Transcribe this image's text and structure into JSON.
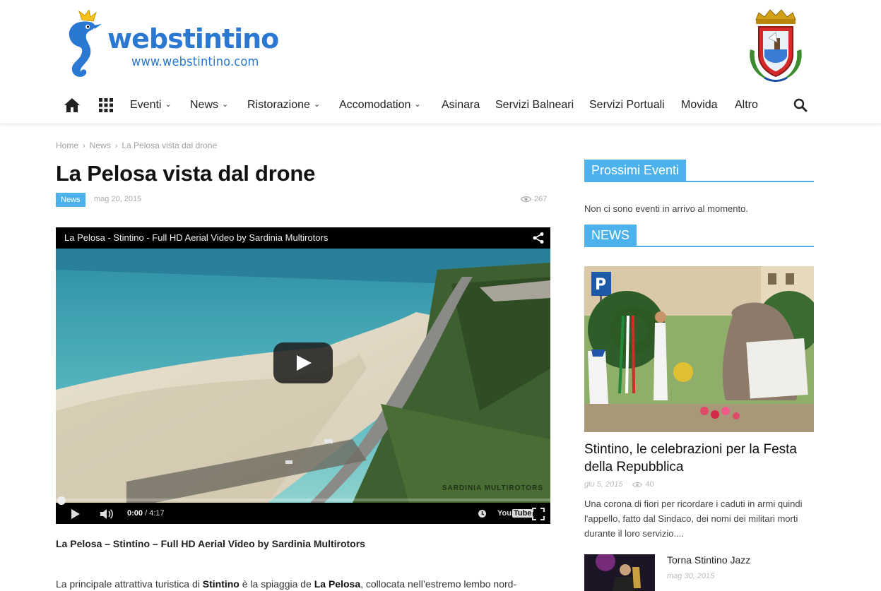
{
  "header": {
    "logo_text": "webstintino",
    "logo_url": "www.webstintino.com"
  },
  "nav": {
    "items": [
      {
        "label": "Eventi",
        "dropdown": true
      },
      {
        "label": "News",
        "dropdown": true
      },
      {
        "label": "Ristorazione",
        "dropdown": true
      },
      {
        "label": "Accomodation",
        "dropdown": true
      },
      {
        "label": "Asinara",
        "dropdown": false
      },
      {
        "label": "Servizi Balneari",
        "dropdown": false
      },
      {
        "label": "Servizi Portuali",
        "dropdown": false
      },
      {
        "label": "Movida",
        "dropdown": false
      },
      {
        "label": "Altro",
        "dropdown": false
      }
    ],
    "chevron": "⌄"
  },
  "breadcrumb": {
    "home": "Home",
    "section": "News",
    "current": "La Pelosa vista dal drone",
    "separator": "›"
  },
  "article": {
    "title": "La Pelosa vista dal drone",
    "category": "News",
    "date": "mag 20, 2015",
    "views": "267",
    "caption": "La Pelosa – Stintino – Full HD Aerial Video by Sardinia Multirotors",
    "body_pre": "La principale attrattiva turistica di ",
    "body_b1": "Stintino",
    "body_mid": " è la spiaggia de ",
    "body_b2": "La Pelosa",
    "body_post": ", collocata nell’estremo lembo nord-"
  },
  "video": {
    "title": "La Pelosa - Stintino - Full HD Aerial Video by Sardinia Multirotors",
    "current_time": "0:00",
    "duration": "/ 4:17",
    "watermark": "SARDINIA MULTIROTORS",
    "yt_left": "You",
    "yt_right": "Tube",
    "progress": 0
  },
  "sidebar": {
    "events_heading": "Prossimi Eventi",
    "events_empty": "Non ci sono eventi in arrivo al momento.",
    "news_heading": "NEWS",
    "featured": {
      "title": "Stintino, le celebrazioni per la Festa della Repubblica",
      "date": "giu 5, 2015",
      "views": "40",
      "excerpt": "Una corona di fiori per ricordare i caduti in armi quindi l'appello, fatto dal Sindaco, dei nomi dei militari morti durante il loro servizio...."
    },
    "second": {
      "title": "Torna Stintino Jazz",
      "date": "mag 30, 2015"
    }
  },
  "colors": {
    "accent": "#4db2ec",
    "logo_blue": "#2a78d2"
  }
}
